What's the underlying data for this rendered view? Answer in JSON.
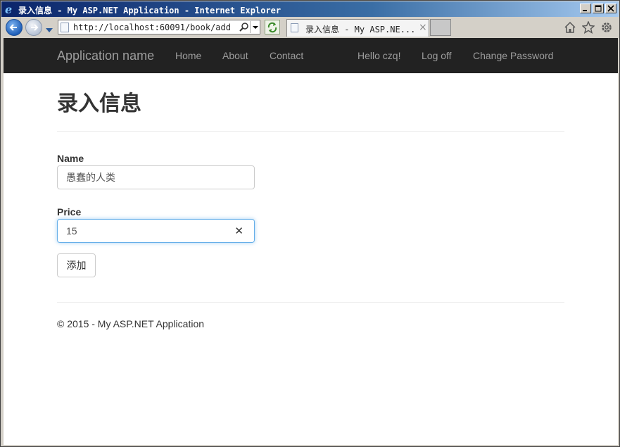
{
  "window": {
    "title": "录入信息 - My ASP.NET Application - Internet Explorer"
  },
  "toolbar": {
    "url": "http://localhost:60091/book/add",
    "tab_title": "录入信息 - My ASP.NE...",
    "tab_close": "×"
  },
  "navbar": {
    "brand": "Application name",
    "links": [
      "Home",
      "About",
      "Contact"
    ],
    "greeting": "Hello czq!",
    "logoff": "Log off",
    "change_password": "Change Password"
  },
  "main": {
    "heading": "录入信息",
    "name_label": "Name",
    "name_value": "愚蠢的人类",
    "price_label": "Price",
    "price_value": "15",
    "clear_glyph": "✕",
    "submit_label": "添加"
  },
  "footer": {
    "text": "© 2015 - My ASP.NET Application"
  },
  "colors": {
    "navbar_bg": "#222222",
    "nav_text": "#9d9d9d",
    "focus_border": "#66afe9",
    "title_bar": "#0a246a"
  }
}
